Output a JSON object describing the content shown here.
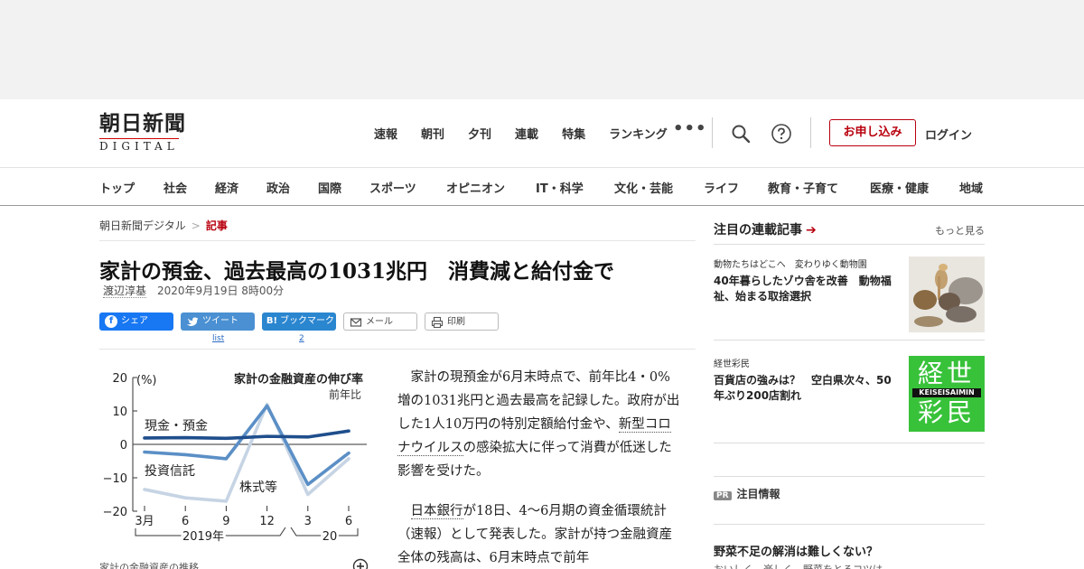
{
  "masthead": {
    "logo_main": "朝日新聞",
    "logo_sub": "DIGITAL",
    "nav": [
      "速報",
      "朝刊",
      "夕刊",
      "連載",
      "特集",
      "ランキング"
    ],
    "more": "•••",
    "subscribe": "お申し込み",
    "login": "ログイン"
  },
  "categories": [
    "トップ",
    "社会",
    "経済",
    "政治",
    "国際",
    "スポーツ",
    "オピニオン",
    "IT・科学",
    "文化・芸能",
    "ライフ",
    "教育・子育て",
    "医療・健康",
    "地域"
  ],
  "breadcrumb": {
    "home": "朝日新聞デジタル",
    "sep": ">",
    "current": "記事"
  },
  "article": {
    "headline": "家計の預金、過去最高の1031兆円　消費減と給付金で",
    "author": "渡辺淳基",
    "date": "2020年9月19日 8時00分",
    "paragraphs": [
      {
        "before": "家計の現預金が6月末時点で、前年比4・0%増の1031兆円と過去最高を記録した。政府が出した1人10万円の特別定額給付金や、",
        "link": "新型コロナウイルス",
        "after": "の感染拡大に伴って消費が低迷した影響を受けた。"
      },
      {
        "before": "",
        "link": "日本銀行",
        "after": "が18日、4～6月期の資金循環統計（速報）として発表した。家計が持つ金融資産全体の残高は、6月末時点で前年"
      }
    ]
  },
  "share": {
    "facebook": "シェア",
    "twitter": "ツイート",
    "hatena": "ブックマーク",
    "mail": "メール",
    "print": "印刷",
    "twitter_count": "list",
    "hatena_count": "2"
  },
  "chart_caption": "家計の金融資産の推移",
  "chart_data": {
    "type": "line",
    "title": "家計の金融資産の伸び率",
    "ylabel": "(%)",
    "subtitle": "前年比",
    "categories": [
      "3月",
      "6",
      "9",
      "12",
      "3",
      "6"
    ],
    "year_labels": [
      "2019年",
      "20"
    ],
    "ylim": [
      -20,
      20
    ],
    "yticks": [
      "20",
      "10",
      "0",
      "−10",
      "−20"
    ],
    "series": [
      {
        "name": "現金・預金",
        "values": [
          1.9,
          2.0,
          1.8,
          2.4,
          2.2,
          4.0
        ],
        "color": "#1f4e8c"
      },
      {
        "name": "投資信託",
        "values": [
          -2.3,
          -3.1,
          -4.3,
          11.5,
          -12.0,
          -2.6
        ],
        "color": "#5b8fc6"
      },
      {
        "name": "株式等",
        "values": [
          -13.5,
          -16.0,
          -17.0,
          12.0,
          -15.0,
          -4.3
        ],
        "color": "#c6d4e4"
      }
    ]
  },
  "sidebar": {
    "title": "注目の連載記事",
    "more": "もっと見る",
    "items": [
      {
        "kicker": "動物たちはどこへ　変わりゆく動物園",
        "title": "40年暮らしたゾウ舎を改善　動物福祉、始まる取捨選択"
      },
      {
        "kicker": "経世彩民",
        "title": "百貨店の強みは？　空白県次々、50年ぶり200店割れ",
        "thumb_main": "経世",
        "thumb_sub": "KEISEISAIMIN",
        "thumb_bottom": "彩民"
      }
    ],
    "pr_badge": "PR",
    "pr_label": "注目情報",
    "pr_title": "野菜不足の解消は難しくない？",
    "pr_sub": "おいしく、楽しく、野菜をとるコツは"
  },
  "colors": {
    "accent": "#b8000e",
    "facebook": "#1877f2",
    "twitter": "#4a90d2",
    "hatena": "#2b86d0",
    "thumb_green": "#38c23a"
  }
}
